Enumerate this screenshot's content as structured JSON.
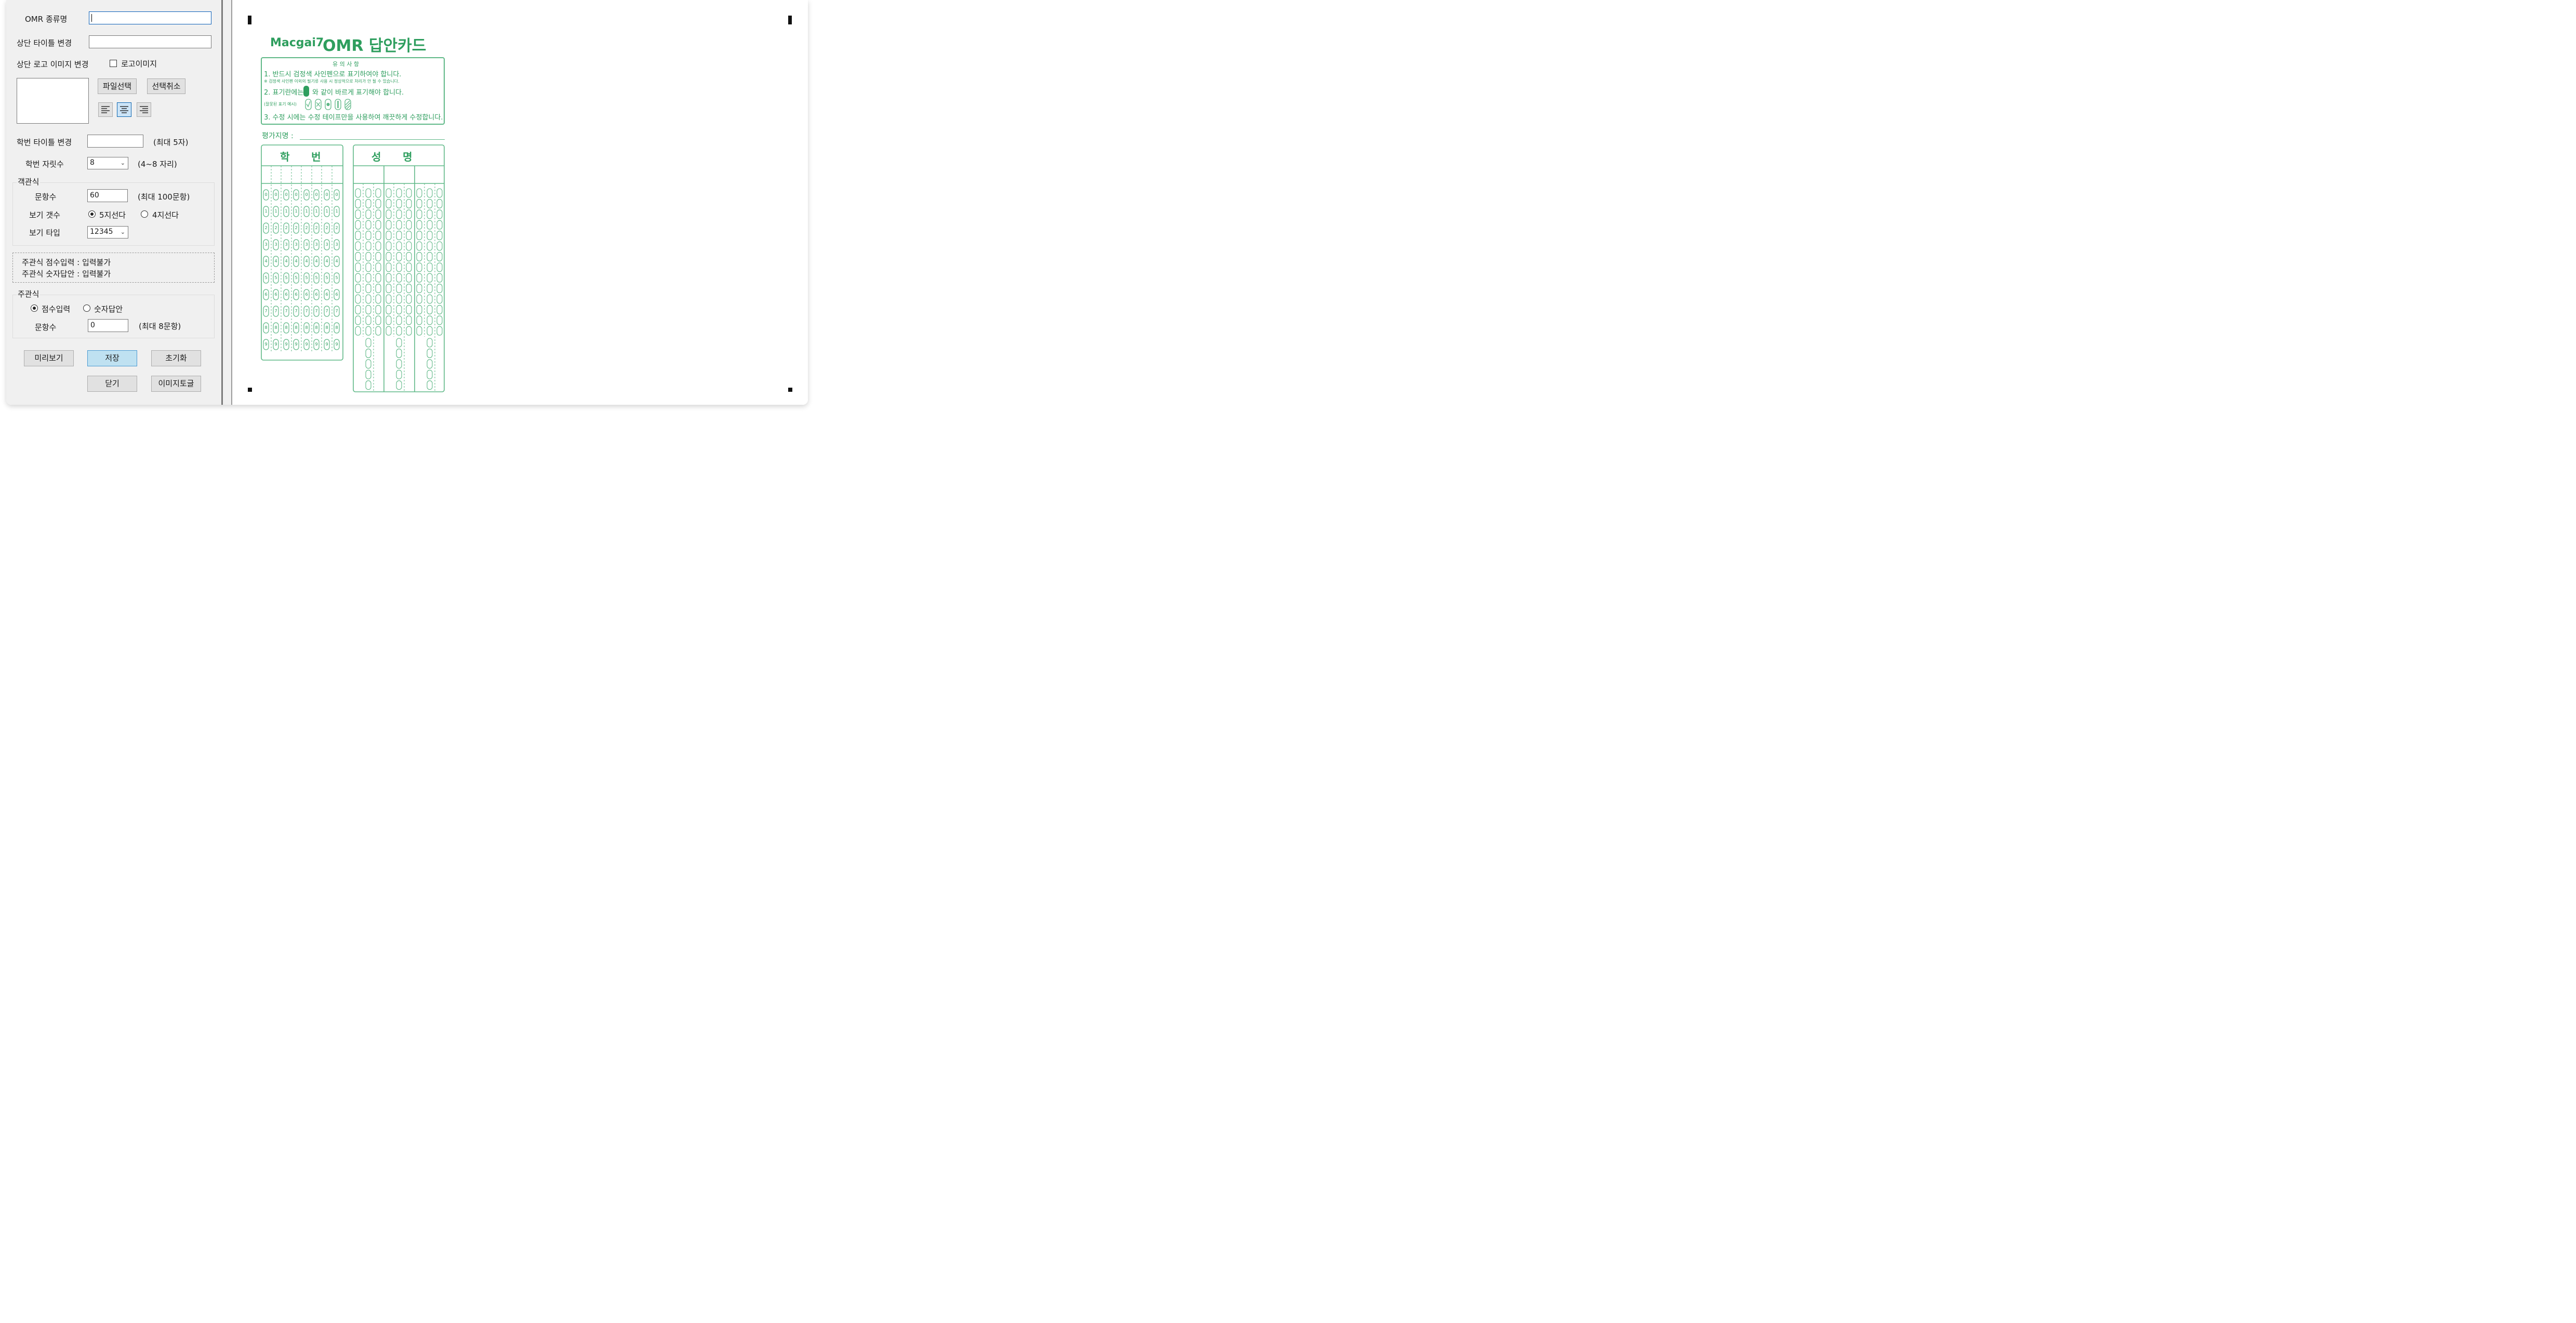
{
  "form": {
    "omr_type_label": "OMR 종류명",
    "omr_type_value": "",
    "top_title_label": "상단 타이틀 변경",
    "top_title_value": "",
    "logo_label": "상단 로고 이미지 변경",
    "logo_checkbox_label": "로고이미지",
    "file_select": "파일선택",
    "select_cancel": "선택취소",
    "student_title_label": "학번 타이틀 변경",
    "student_title_value": "",
    "student_title_hint": "(최대 5자)",
    "digits_label": "학번 자릿수",
    "digits_value": "8",
    "digits_hint": "(4~8 자리)"
  },
  "objective": {
    "group_title": "객관식",
    "count_label": "문항수",
    "count_value": "60",
    "count_hint": "(최대 100문항)",
    "choices_label": "보기 갯수",
    "choice5": "5지선다",
    "choice4": "4지선다",
    "type_label": "보기 타입",
    "type_value": "12345"
  },
  "notice": {
    "line1": "주관식 점수입력 : 입력불가",
    "line2": "주관식 숫자답안 : 입력불가"
  },
  "subjective": {
    "group_title": "주관식",
    "score_input": "점수입력",
    "number_answer": "숫자답안",
    "count_label": "문항수",
    "count_value": "0",
    "count_hint": "(최대 8문항)"
  },
  "buttons": {
    "preview": "미리보기",
    "save": "저장",
    "reset": "초기화",
    "close": "닫기",
    "image_to_text": "이미지토글"
  },
  "card": {
    "logo": "Macgai7",
    "title": "OMR 답안카드",
    "notes_title": "유 의 사 항",
    "note1": "1. 반드시 검정색 사인펜으로 표기하여야 합니다.",
    "note1_sub": "※ 검정색 사인펜 이외의 필기류 사용 시 정상적으로 처리가 안 될 수 있습니다.",
    "note2": "2. 표기란에는",
    "note2_tail": "와 같이 바르게 표기해야 합니다.",
    "wrong_example": "(잘못된 표기 예시)",
    "note3": "3. 수정 시에는 수정 테이프만을 사용하여 깨끗하게 수정합니다.",
    "eval_label": "평가지명 :",
    "student_no_header": "학      번",
    "name_header": "성      명",
    "digits": [
      "0",
      "1",
      "2",
      "3",
      "4",
      "5",
      "6",
      "7",
      "8",
      "9"
    ],
    "accent_color": "#2e9e5e"
  }
}
